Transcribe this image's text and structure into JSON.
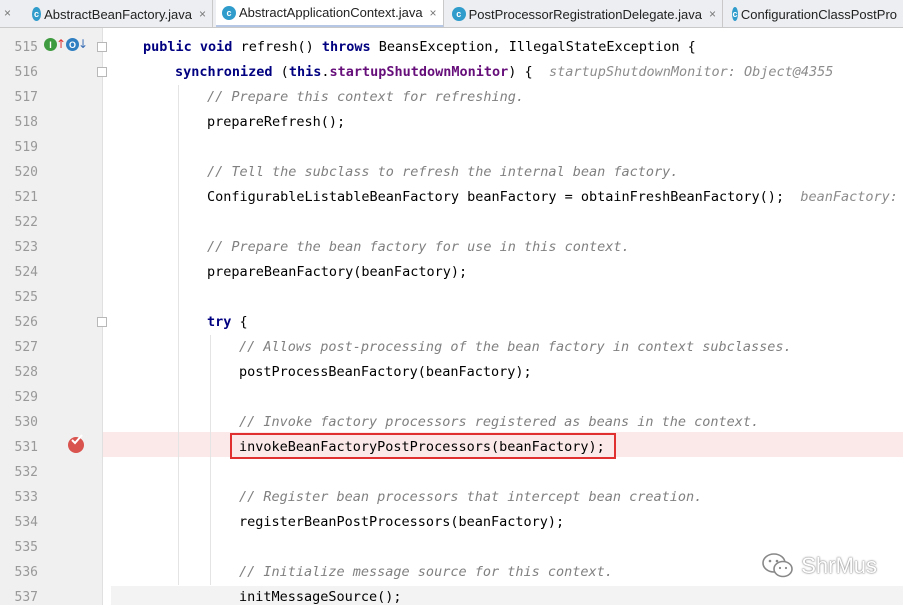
{
  "tabs": [
    {
      "label": "AbstractBeanFactory.java",
      "active": false,
      "closable": true
    },
    {
      "label": "AbstractApplicationContext.java",
      "active": true,
      "closable": true
    },
    {
      "label": "PostProcessorRegistrationDelegate.java",
      "active": false,
      "closable": true
    },
    {
      "label": "ConfigurationClassPostPro",
      "active": false,
      "closable": false
    }
  ],
  "close_glyph": "×",
  "class_icon_letter": "c",
  "gutter_icons": {
    "implements_letter": "I",
    "override_letter": "O"
  },
  "lines": {
    "l515": {
      "num": "515",
      "kw1": "public",
      "kw2": "void",
      "rest1": " refresh() ",
      "kw3": "throws",
      "rest2": " BeansException, IllegalStateException {"
    },
    "l516": {
      "num": "516",
      "kw1": "synchronized",
      "rest1": " (",
      "kw2": "this",
      "dot": ".",
      "field": "startupShutdownMonitor",
      "rest2": ") {",
      "hint": "startupShutdownMonitor: Object@4355"
    },
    "l517": {
      "num": "517",
      "comment": "// Prepare this context for refreshing."
    },
    "l518": {
      "num": "518",
      "code": "prepareRefresh();"
    },
    "l519": {
      "num": "519"
    },
    "l520": {
      "num": "520",
      "comment": "// Tell the subclass to refresh the internal bean factory."
    },
    "l521": {
      "num": "521",
      "code": "ConfigurableListableBeanFactory beanFactory = obtainFreshBeanFactory();",
      "hint": "beanFactory: \""
    },
    "l522": {
      "num": "522"
    },
    "l523": {
      "num": "523",
      "comment": "// Prepare the bean factory for use in this context."
    },
    "l524": {
      "num": "524",
      "code": "prepareBeanFactory(beanFactory);"
    },
    "l525": {
      "num": "525"
    },
    "l526": {
      "num": "526",
      "kw1": "try",
      "rest1": " {"
    },
    "l527": {
      "num": "527",
      "comment": "// Allows post-processing of the bean factory in context subclasses."
    },
    "l528": {
      "num": "528",
      "code": "postProcessBeanFactory(beanFactory);"
    },
    "l529": {
      "num": "529"
    },
    "l530": {
      "num": "530",
      "comment": "// Invoke factory processors registered as beans in the context."
    },
    "l531": {
      "num": "531",
      "code": "invokeBeanFactoryPostProcessors(beanFactory);"
    },
    "l532": {
      "num": "532"
    },
    "l533": {
      "num": "533",
      "comment": "// Register bean processors that intercept bean creation."
    },
    "l534": {
      "num": "534",
      "code": "registerBeanPostProcessors(beanFactory);"
    },
    "l535": {
      "num": "535"
    },
    "l536": {
      "num": "536",
      "comment": "// Initialize message source for this context."
    },
    "l537": {
      "num": "537",
      "code": "initMessageSource();"
    }
  },
  "watermark": {
    "text": "ShrMus",
    "icon": "wechat-icon"
  },
  "colors": {
    "keyword": "#000080",
    "field": "#660e7a",
    "comment": "#808080",
    "breakpoint": "#d9534f",
    "highlight": "#fbe9e9",
    "annotation_box": "#e03030"
  }
}
